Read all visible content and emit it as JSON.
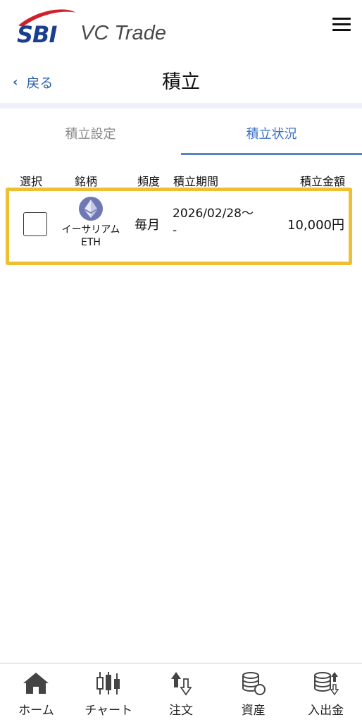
{
  "header": {
    "logo_sbi": "SBI",
    "logo_vc": "VC Trade",
    "menu_icon": "hamburger-menu-icon"
  },
  "nav": {
    "back_label": "戻る",
    "title": "積立"
  },
  "tabs": [
    {
      "label": "積立設定",
      "active": false
    },
    {
      "label": "積立状況",
      "active": true
    }
  ],
  "table": {
    "columns": [
      "選択",
      "銘柄",
      "頻度",
      "積立期間",
      "積立金額"
    ],
    "rows": [
      {
        "coin_name": "イーサリアム",
        "coin_symbol": "ETH",
        "coin_icon": "ethereum-icon",
        "frequency": "毎月",
        "period_line1": "2026/02/28～",
        "period_line2": "-",
        "amount": "10,000円",
        "selected": false
      }
    ]
  },
  "colors": {
    "accent": "#3b6fc4",
    "highlight": "#f0be32",
    "brand": "#1a3f8f",
    "brand_red": "#d0202b"
  },
  "bottom_nav": [
    {
      "label": "ホーム",
      "icon": "home-icon"
    },
    {
      "label": "チャート",
      "icon": "chart-icon"
    },
    {
      "label": "注文",
      "icon": "order-icon"
    },
    {
      "label": "資産",
      "icon": "assets-icon"
    },
    {
      "label": "入出金",
      "icon": "deposit-withdraw-icon"
    }
  ]
}
